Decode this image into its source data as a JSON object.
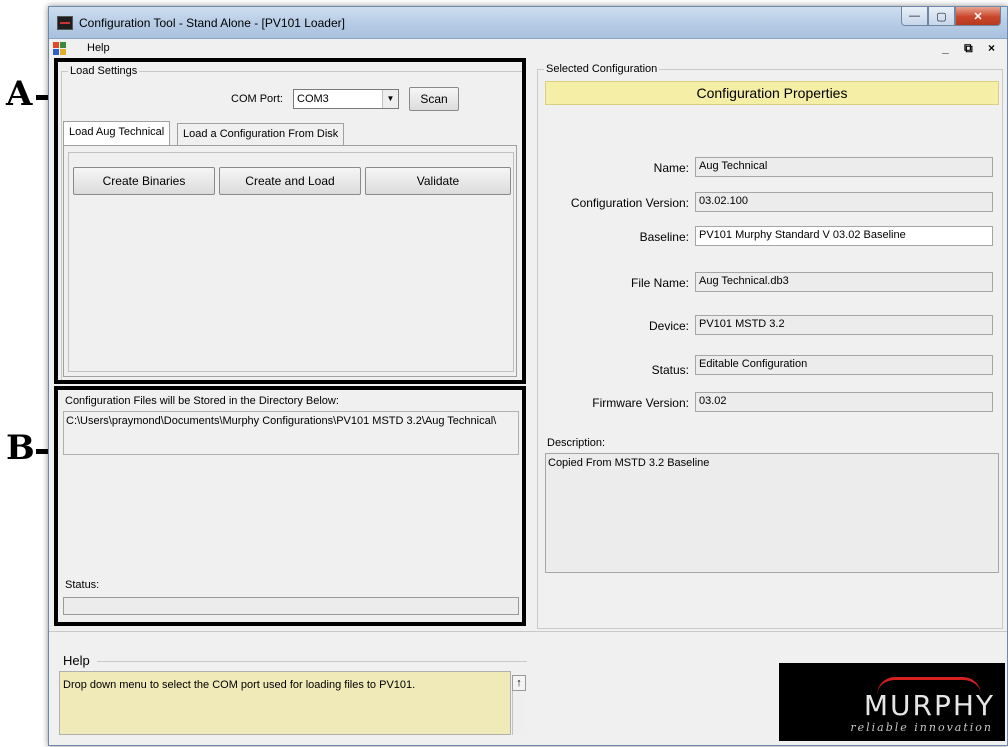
{
  "annotations": {
    "a": "A",
    "b": "B"
  },
  "window": {
    "title": "Configuration Tool - Stand Alone - [PV101 Loader]",
    "min_glyph": "—",
    "max_glyph": "▢",
    "close_glyph": "✕"
  },
  "menu": {
    "help": "Help",
    "mdi_controls": "_ ⧉ ×"
  },
  "load_settings": {
    "title": "Load Settings",
    "com_port_label": "COM Port:",
    "com_port_value": "COM3",
    "scan_label": "Scan",
    "tabs": [
      "Load Aug Technical",
      "Load a Configuration From Disk"
    ],
    "buttons": {
      "create_binaries": "Create Binaries",
      "create_and_load": "Create and Load",
      "validate": "Validate"
    }
  },
  "directory": {
    "caption": "Configuration Files will be Stored in the Directory Below:",
    "path": "C:\\Users\\praymond\\Documents\\Murphy Configurations\\PV101 MSTD 3.2\\Aug Technical\\",
    "status_label": "Status:",
    "status_value": ""
  },
  "selected_configuration": {
    "title": "Selected Configuration",
    "header": "Configuration  Properties",
    "properties": [
      {
        "label": "Name:",
        "value": "Aug Technical"
      },
      {
        "label": "Configuration Version:",
        "value": "03.02.100"
      },
      {
        "label": "Baseline:",
        "value": "PV101 Murphy Standard V 03.02 Baseline"
      },
      {
        "label": "File Name:",
        "value": "Aug Technical.db3"
      },
      {
        "label": "Device:",
        "value": "PV101 MSTD 3.2"
      },
      {
        "label": "Status:",
        "value": "Editable Configuration"
      },
      {
        "label": "Firmware Version:",
        "value": "03.02"
      }
    ],
    "description_label": "Description:",
    "description_value": "Copied From MSTD 3.2 Baseline"
  },
  "help_panel": {
    "title": "Help",
    "text": "Drop down menu to select the COM port used for loading files to PV101.",
    "up_glyph": "↑"
  },
  "logo": {
    "brand": "MURPHY",
    "tagline": "reliable innovation"
  },
  "colors": {
    "help_bg": "#f0e9b8",
    "header_bg": "#f4eea6",
    "logo_bg": "#000000",
    "logo_red": "#d42020"
  }
}
